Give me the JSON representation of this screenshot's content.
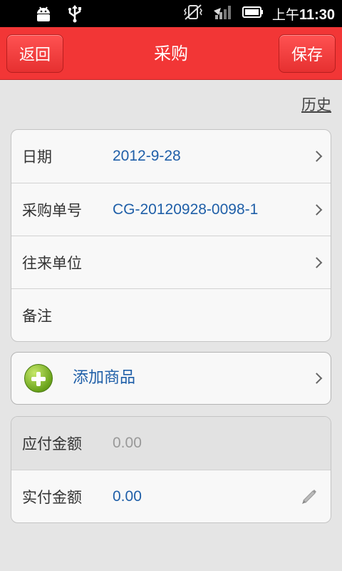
{
  "status_bar": {
    "time_prefix": "上午",
    "time": "11:30",
    "icons": [
      "android-debug-icon",
      "usb-icon",
      "vibrate-off-icon",
      "signal-icon",
      "battery-icon"
    ]
  },
  "title_bar": {
    "back_label": "返回",
    "title": "采购",
    "save_label": "保存",
    "color": "#f23636"
  },
  "history_link": "历史",
  "info_form": {
    "date_label": "日期",
    "date_value": "2012-9-28",
    "order_no_label": "采购单号",
    "order_no_value": "CG-20120928-0098-1",
    "partner_label": "往来单位",
    "partner_value": "",
    "note_label": "备注",
    "note_value": ""
  },
  "add_goods_label": "添加商品",
  "payment": {
    "payable_label": "应付金额",
    "payable_value": "0.00",
    "paid_label": "实付金额",
    "paid_value": "0.00"
  }
}
